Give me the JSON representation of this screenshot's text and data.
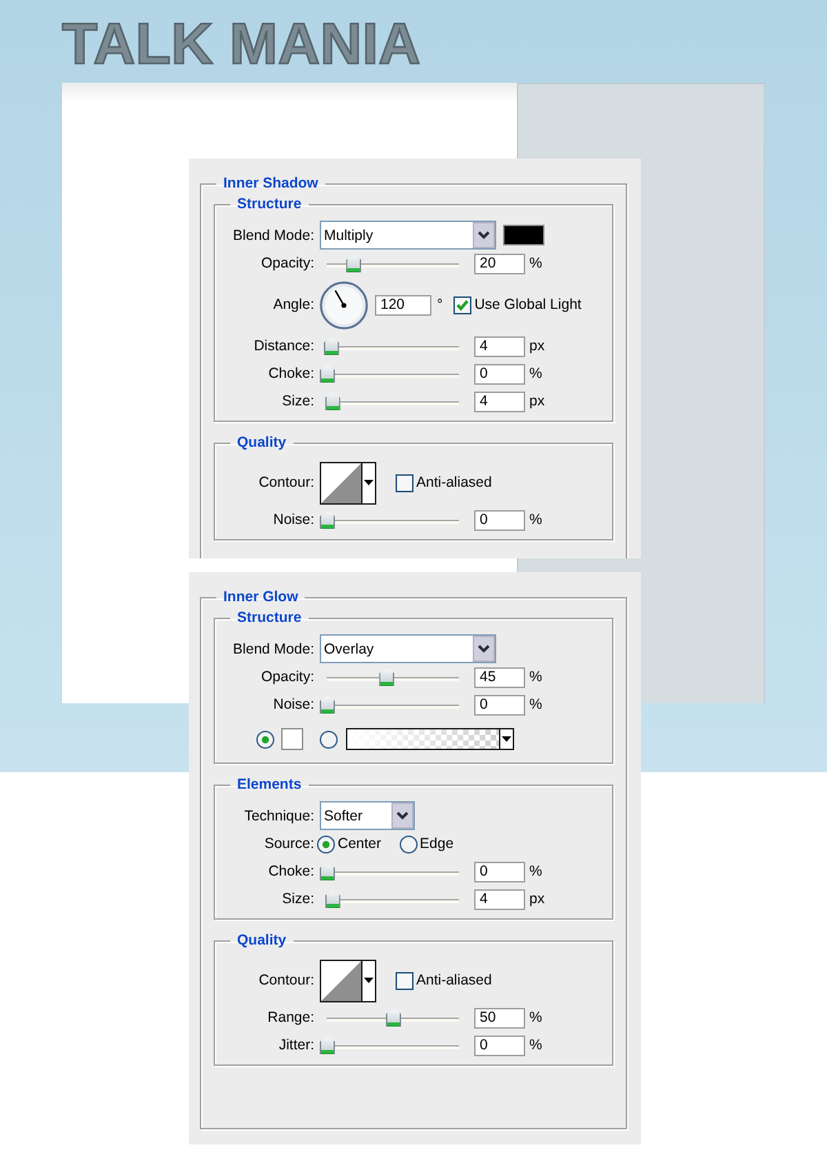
{
  "site": {
    "title": "TALK MANIA"
  },
  "panels": [
    {
      "title": "Inner Shadow",
      "sections": [
        {
          "title": "Structure",
          "rows": [
            {
              "kind": "dropdown",
              "label": "Blend Mode:",
              "value": "Multiply",
              "color": "#000000"
            },
            {
              "kind": "slider",
              "label": "Opacity:",
              "level": 0.2,
              "value": "20",
              "unit": "%"
            },
            {
              "kind": "angle",
              "label": "Angle:",
              "value": "120",
              "unit": "°",
              "checkbox": {
                "label": "Use Global Light",
                "checked": true
              }
            },
            {
              "kind": "slider",
              "label": "Distance:",
              "level": 0.03,
              "value": "4",
              "unit": "px"
            },
            {
              "kind": "slider",
              "label": "Choke:",
              "level": 0,
              "value": "0",
              "unit": "%"
            },
            {
              "kind": "slider",
              "label": "Size:",
              "level": 0.04,
              "value": "4",
              "unit": "px"
            }
          ]
        },
        {
          "title": "Quality",
          "rows": [
            {
              "kind": "contour",
              "label": "Contour:",
              "checkbox": {
                "label": "Anti-aliased",
                "checked": false
              }
            },
            {
              "kind": "slider",
              "label": "Noise:",
              "level": 0,
              "value": "0",
              "unit": "%"
            }
          ]
        }
      ]
    },
    {
      "title": "Inner Glow",
      "sections": [
        {
          "title": "Structure",
          "rows": [
            {
              "kind": "dropdown",
              "label": "Blend Mode:",
              "value": "Overlay"
            },
            {
              "kind": "slider",
              "label": "Opacity:",
              "level": 0.45,
              "value": "45",
              "unit": "%"
            },
            {
              "kind": "slider",
              "label": "Noise:",
              "level": 0,
              "value": "0",
              "unit": "%"
            },
            {
              "kind": "fill",
              "options": [
                {
                  "kind": "color",
                  "selected": true,
                  "color": "#ffffff"
                },
                {
                  "kind": "gradient",
                  "selected": false
                }
              ]
            }
          ]
        },
        {
          "title": "Elements",
          "rows": [
            {
              "kind": "dropdown",
              "label": "Technique:",
              "value": "Softer"
            },
            {
              "kind": "radio",
              "label": "Source:",
              "options": [
                {
                  "label": "Center",
                  "selected": true
                },
                {
                  "label": "Edge",
                  "selected": false
                }
              ]
            },
            {
              "kind": "slider",
              "label": "Choke:",
              "level": 0,
              "value": "0",
              "unit": "%"
            },
            {
              "kind": "slider",
              "label": "Size:",
              "level": 0.04,
              "value": "4",
              "unit": "px"
            }
          ]
        },
        {
          "title": "Quality",
          "rows": [
            {
              "kind": "contour",
              "label": "Contour:",
              "checkbox": {
                "label": "Anti-aliased",
                "checked": false
              }
            },
            {
              "kind": "slider",
              "label": "Range:",
              "level": 0.5,
              "value": "50",
              "unit": "%"
            },
            {
              "kind": "slider",
              "label": "Jitter:",
              "level": 0,
              "value": "0",
              "unit": "%"
            }
          ]
        }
      ]
    }
  ]
}
